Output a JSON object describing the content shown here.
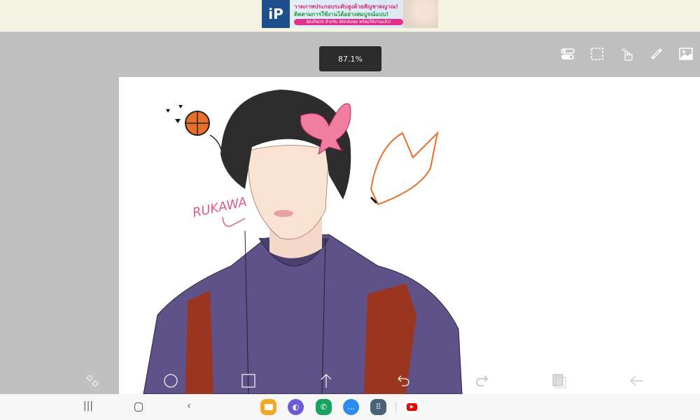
{
  "ad": {
    "logo": "iP",
    "line1": "วาดภาพประกอบระดับสูงด้วยสัญชาตญาณ!",
    "line2": "ติดตามการใช้งานได้อย่างสมบูรณ์แบบ!",
    "cta": "ibisPaint สำหรับ Windows พร้อมใช้งานแล้ว!"
  },
  "zoom_level": "87.1%",
  "top_tools": [
    "toggle-icon",
    "selection-icon",
    "hand-icon",
    "ruler-icon",
    "image-icon"
  ],
  "bottom_tools": [
    "transform-icon",
    "brush-circle-icon",
    "square-icon",
    "up-arrow-icon",
    "undo-icon",
    "redo-icon",
    "layers-icon",
    "back-arrow-icon"
  ],
  "drawing": {
    "signature": "RUKAWA"
  },
  "taskbar": {
    "apps": [
      "my-files",
      "internet",
      "phone",
      "messages",
      "apps-drawer",
      "youtube"
    ],
    "colors": {
      "my-files": "#f5a623",
      "internet": "#6b5bd6",
      "phone": "#1aa360",
      "messages": "#2b8cf0",
      "apps-drawer": "#4a6278",
      "youtube": "#ffffff"
    }
  }
}
